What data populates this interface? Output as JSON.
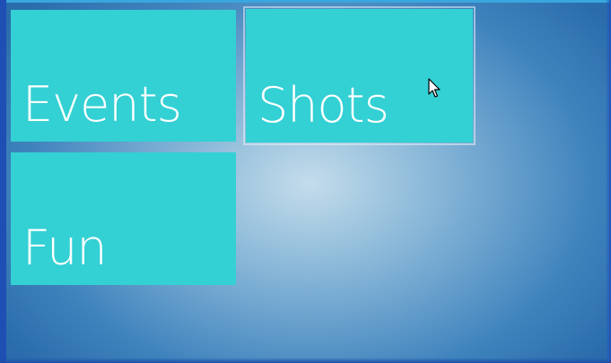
{
  "tiles": [
    {
      "label": "Events",
      "selected": false
    },
    {
      "label": "Shots",
      "selected": true
    },
    {
      "label": "Fun",
      "selected": false
    }
  ],
  "icons": {
    "cursor": "mouse-pointer-icon"
  },
  "colors": {
    "tile": "#33d0d4",
    "tile_text": "#ffffff",
    "background_center": "#c4dceb",
    "background_edge": "#2a6cab",
    "top_edge": "#3aa6de",
    "left_edge": "#1f4fb4"
  }
}
